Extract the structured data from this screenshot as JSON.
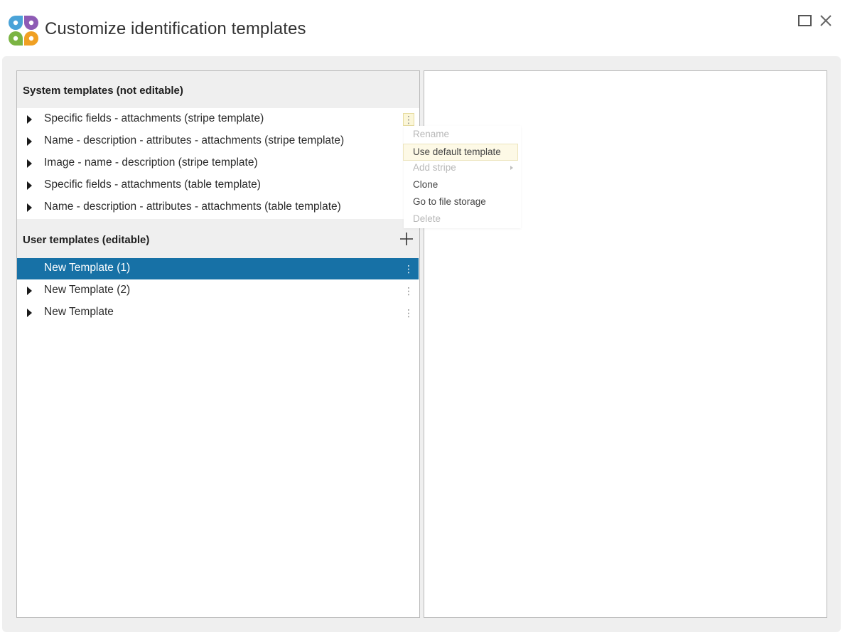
{
  "window": {
    "title": "Customize identification templates",
    "accent_color": "#1771a6",
    "logo_colors": [
      "#4aa3d8",
      "#8e5bb5",
      "#7bb443",
      "#f0a022"
    ]
  },
  "system_section": {
    "title": "System templates (not editable)",
    "items": [
      {
        "label": "Specific fields - attachments (stripe template)"
      },
      {
        "label": "Name - description - attributes - attachments (stripe template)"
      },
      {
        "label": "Image - name - description (stripe template)"
      },
      {
        "label": "Specific fields - attachments (table template)"
      },
      {
        "label": "Name - description - attributes - attachments (table template)"
      }
    ]
  },
  "user_section": {
    "title": "User templates (editable)",
    "items": [
      {
        "label": "New Template (1)",
        "selected": true
      },
      {
        "label": "New Template (2)",
        "selected": false
      },
      {
        "label": "New Template",
        "selected": false
      }
    ]
  },
  "context_menu": {
    "items": [
      {
        "label": "Rename",
        "enabled": false
      },
      {
        "label": "Use default template",
        "enabled": true,
        "highlighted": true
      },
      {
        "label": "Add stripe",
        "enabled": false,
        "has_submenu": true
      },
      {
        "label": "Clone",
        "enabled": true
      },
      {
        "label": "Go to file storage",
        "enabled": true
      },
      {
        "label": "Delete",
        "enabled": false
      }
    ]
  },
  "icons": {
    "logo": "app-logo-icon",
    "maximize": "maximize-icon",
    "close": "close-icon",
    "expand": "expand-arrow-icon",
    "more": "more-vertical-icon",
    "add": "plus-icon"
  }
}
